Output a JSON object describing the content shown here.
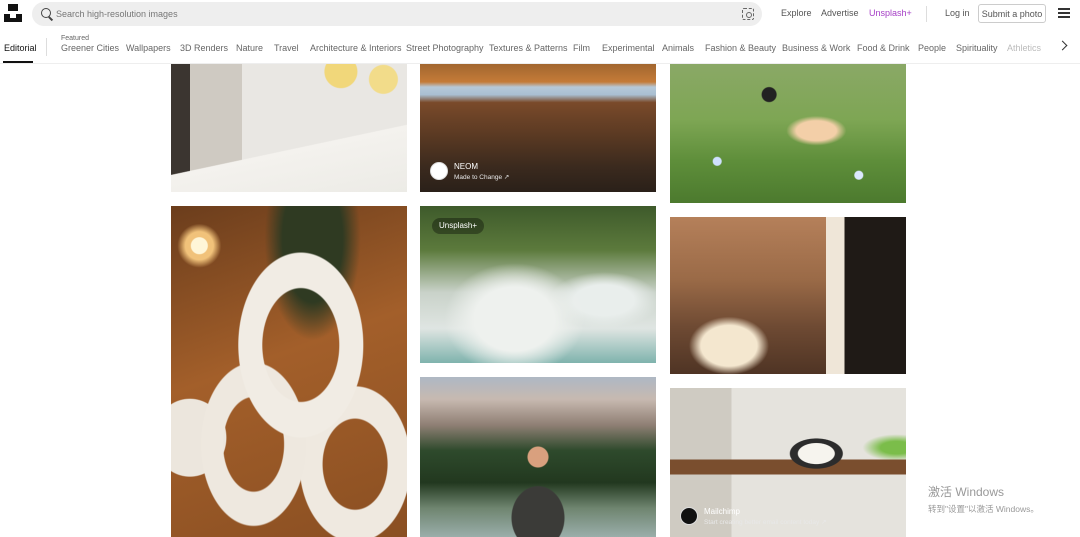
{
  "header": {
    "search_placeholder": "Search high-resolution images",
    "nav": {
      "explore": "Explore",
      "advertise": "Advertise",
      "unsplash_plus": "Unsplash+",
      "login": "Log in"
    },
    "submit_label": "Submit a photo"
  },
  "topics": {
    "editorial": "Editorial",
    "featured_label": "Featured",
    "items": [
      "Greener Cities",
      "Wallpapers",
      "3D Renders",
      "Nature",
      "Travel",
      "Architecture & Interiors",
      "Street Photography",
      "Textures & Patterns",
      "Film",
      "Experimental",
      "Animals",
      "Fashion & Beauty",
      "Business & Work",
      "Food & Drink",
      "People",
      "Spirituality",
      "Athletics"
    ]
  },
  "photos": {
    "neom": {
      "name": "NEOM",
      "tagline": "Made to Change ↗"
    },
    "waterfall": {
      "badge": "Unsplash+"
    },
    "mailchimp": {
      "name": "Mailchimp",
      "tagline": "Start creating better email content today ↗"
    }
  },
  "watermark": {
    "line1": "激活 Windows",
    "line2": "转到\"设置\"以激活 Windows。"
  },
  "colors": {
    "accent_plus": "#a53ec6"
  }
}
